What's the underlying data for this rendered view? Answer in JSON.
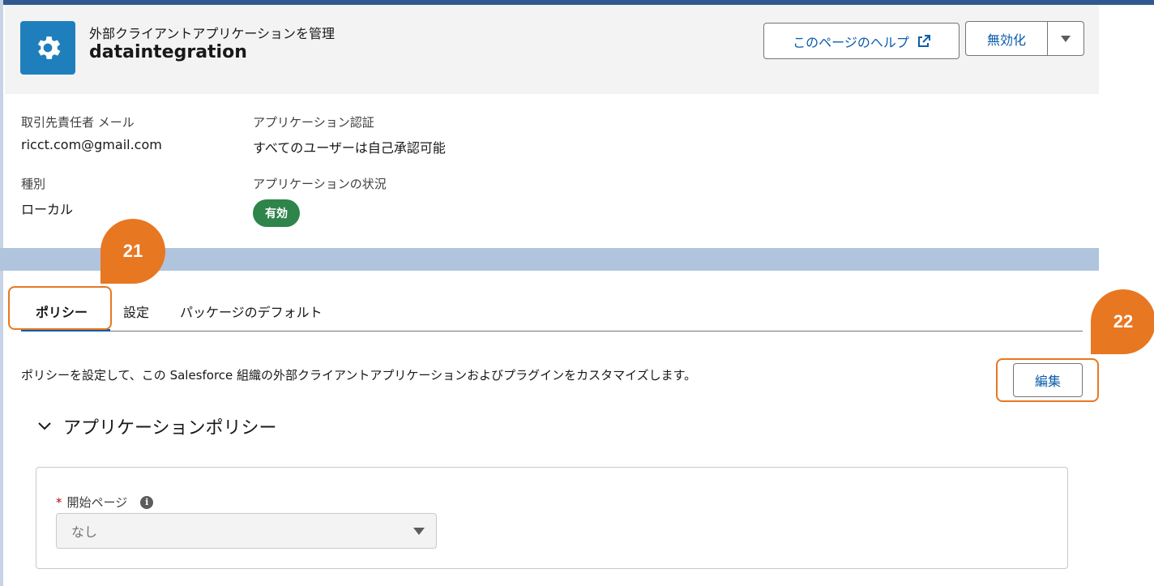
{
  "header": {
    "eyebrow": "外部クライアントアプリケーションを管理",
    "title": "dataintegration",
    "help_button": "このページのヘルプ",
    "disable_button": "無効化"
  },
  "details": {
    "contact_email_label": "取引先責任者 メール",
    "contact_email_value": "ricct.com@gmail.com",
    "app_auth_label": "アプリケーション認証",
    "app_auth_value": "すべてのユーザーは自己承認可能",
    "type_label": "種別",
    "type_value": "ローカル",
    "status_label": "アプリケーションの状況",
    "status_value": "有効"
  },
  "tabs": [
    {
      "label": "ポリシー",
      "active": true
    },
    {
      "label": "設定",
      "active": false
    },
    {
      "label": "パッケージのデフォルト",
      "active": false
    }
  ],
  "policies": {
    "description": "ポリシーを設定して、この Salesforce 組織の外部クライアントアプリケーションおよびプラグインをカスタマイズします。",
    "edit_button": "編集",
    "section_title": "アプリケーションポリシー",
    "start_page_required": "*",
    "start_page_label": "開始ページ",
    "start_page_value": "なし"
  },
  "callouts": {
    "tab_marker": "21",
    "edit_marker": "22"
  },
  "colors": {
    "brand_blue": "#0b5cab",
    "icon_blue": "#1f7fbd",
    "status_green": "#2e844a",
    "callout_orange": "#e87722"
  }
}
